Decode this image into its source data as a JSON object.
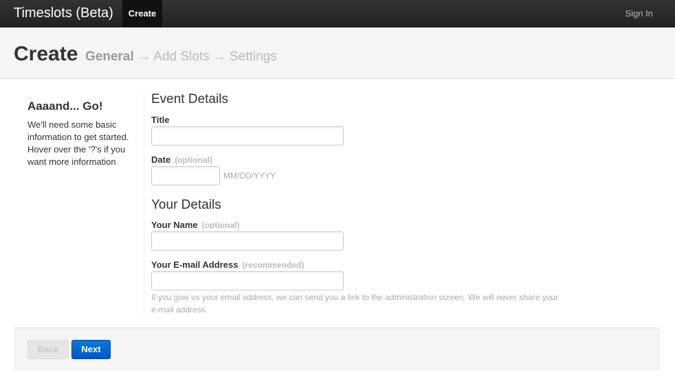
{
  "navbar": {
    "brand": "Timeslots (Beta)",
    "active_item": "Create",
    "sign_in": "Sign In"
  },
  "header": {
    "title": "Create",
    "steps": {
      "current": "General",
      "step2": "Add Slots",
      "step3": "Settings",
      "arrow": "→"
    }
  },
  "sidebar": {
    "heading": "Aaaand... Go!",
    "text": "We'll need some basic information to get started. Hover over the '?'s if you want more information"
  },
  "event_details": {
    "legend": "Event Details",
    "title_label": "Title",
    "title_value": "",
    "date_label": "Date",
    "date_note": "(optional)",
    "date_value": "",
    "date_format": "MM/DD/YYYY"
  },
  "your_details": {
    "legend": "Your Details",
    "name_label": "Your Name",
    "name_note": "(optional)",
    "name_value": "",
    "email_label": "Your E-mail Address",
    "email_note": "(recommended)",
    "email_value": "",
    "email_help": "If you give us your email address, we can send you a link to the administration screen. We will never share your e-mail address."
  },
  "actions": {
    "back_label": "Back",
    "next_label": "Next"
  }
}
